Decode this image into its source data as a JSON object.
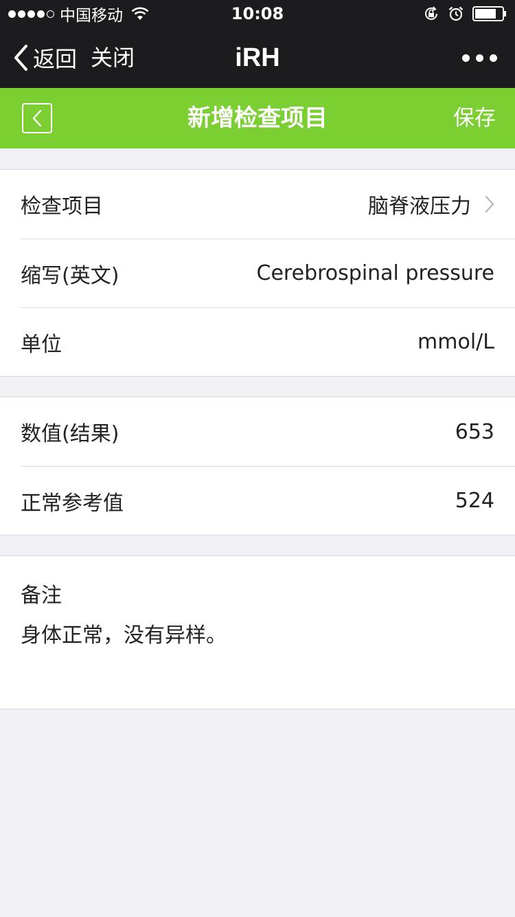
{
  "status_bar": {
    "carrier": "中国移动",
    "time": "10:08",
    "signal_bars": 4,
    "signal_total": 5
  },
  "nav_bar": {
    "back_label": "返回",
    "close_label": "关闭",
    "title": "iRH",
    "more_icon": "more-dots-icon"
  },
  "page_header": {
    "title": "新增检查项目",
    "save_label": "保存",
    "background_color": "#7ccf33"
  },
  "form": {
    "item": {
      "label": "检查项目",
      "value": "脑脊液压力"
    },
    "abbreviation": {
      "label": "缩写(英文)",
      "value": "Cerebrospinal pressure"
    },
    "unit": {
      "label": "单位",
      "value": "mmol/L"
    },
    "result": {
      "label": "数值(结果)",
      "value": "653"
    },
    "reference": {
      "label": "正常参考值",
      "value": "524"
    },
    "notes": {
      "label": "备注",
      "value": "身体正常，没有异样。"
    }
  }
}
